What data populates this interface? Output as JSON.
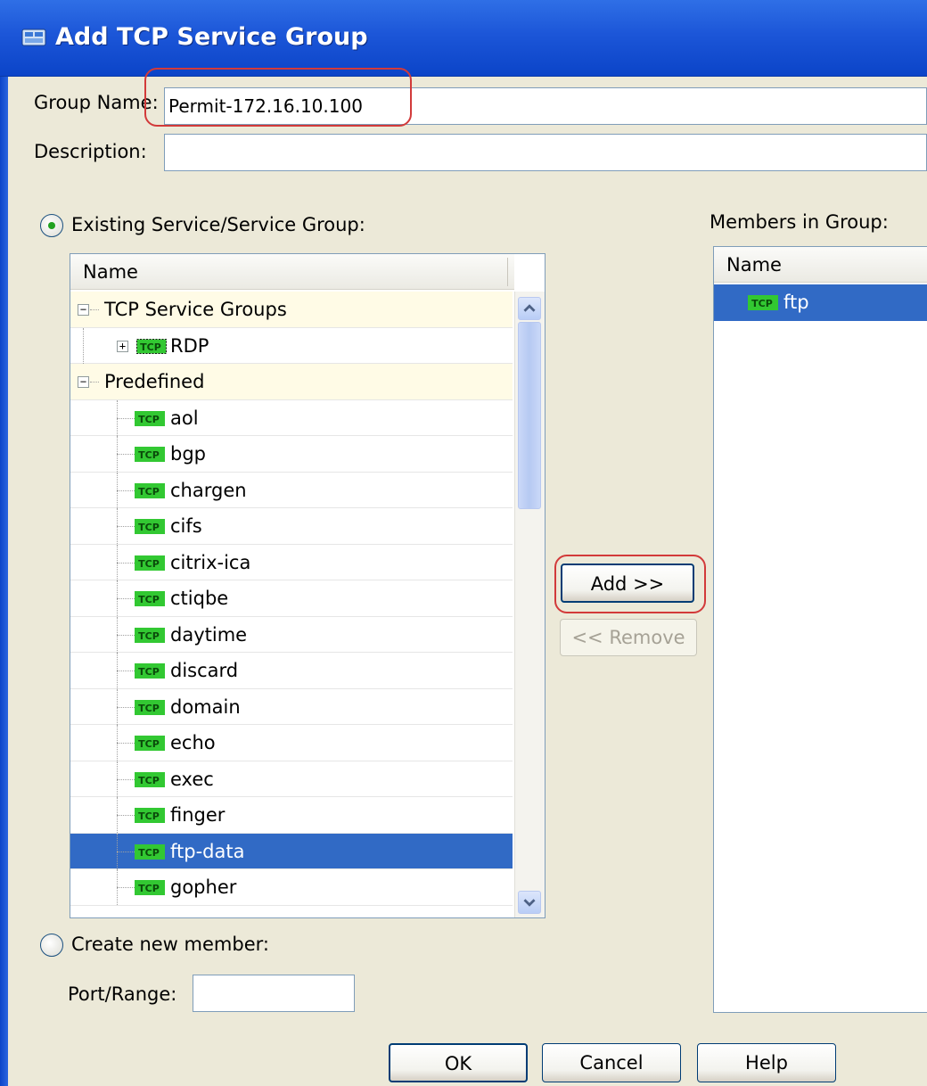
{
  "window": {
    "title": "Add TCP Service Group",
    "icon": "service-group-icon"
  },
  "form": {
    "group_name_label": "Group Name:",
    "group_name_value": "Permit-172.16.10.100",
    "description_label": "Description:",
    "description_value": ""
  },
  "existing": {
    "radio_label": "Existing Service/Service Group:",
    "selected": true,
    "column_header": "Name",
    "groups": [
      {
        "label": "TCP Service Groups",
        "expanded": true
      },
      {
        "label": "Predefined",
        "expanded": true
      }
    ],
    "rdp_item": {
      "icon": "TCP",
      "label": "RDP",
      "expanded": false
    },
    "predefined_items": [
      {
        "icon": "TCP",
        "label": "aol"
      },
      {
        "icon": "TCP",
        "label": "bgp"
      },
      {
        "icon": "TCP",
        "label": "chargen"
      },
      {
        "icon": "TCP",
        "label": "cifs"
      },
      {
        "icon": "TCP",
        "label": "citrix-ica"
      },
      {
        "icon": "TCP",
        "label": "ctiqbe"
      },
      {
        "icon": "TCP",
        "label": "daytime"
      },
      {
        "icon": "TCP",
        "label": "discard"
      },
      {
        "icon": "TCP",
        "label": "domain"
      },
      {
        "icon": "TCP",
        "label": "echo"
      },
      {
        "icon": "TCP",
        "label": "exec"
      },
      {
        "icon": "TCP",
        "label": "finger"
      },
      {
        "icon": "TCP",
        "label": "ftp-data",
        "selected": true
      },
      {
        "icon": "TCP",
        "label": "gopher"
      }
    ]
  },
  "actions": {
    "add": "Add >>",
    "remove": "<< Remove"
  },
  "members": {
    "label": "Members in Group:",
    "column_header": "Name",
    "items": [
      {
        "icon": "TCP",
        "label": "ftp",
        "selected": true
      }
    ]
  },
  "create_new": {
    "radio_label": "Create new member:",
    "selected": false,
    "port_label": "Port/Range:",
    "port_value": ""
  },
  "buttons": {
    "ok": "OK",
    "cancel": "Cancel",
    "help": "Help"
  },
  "colors": {
    "title_bar": "#1c56d8",
    "highlight_circle": "#d23a3a",
    "selection": "#316ac5",
    "tcp_icon": "#32c832"
  }
}
